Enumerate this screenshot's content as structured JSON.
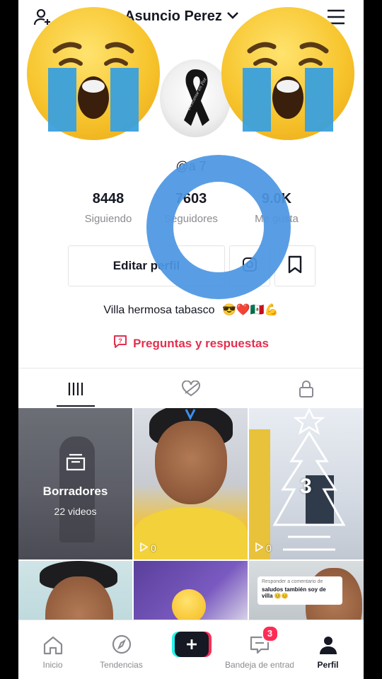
{
  "header": {
    "username": "Asuncio Perez",
    "add_user_icon": "person-plus-icon",
    "chevron_icon": "chevron-down-icon",
    "menu_icon": "hamburger-menu-icon"
  },
  "profile": {
    "handle": "@a                 7",
    "avatar_caption": "Descanse en Paz",
    "stats": [
      {
        "value": "8448",
        "label": "Siguiendo"
      },
      {
        "value": "7603",
        "label": "Seguidores"
      },
      {
        "value": "9.0K",
        "label": "Me gusta"
      }
    ],
    "edit_button": "Editar perfil",
    "bio": "Villa hermosa tabasco",
    "bio_emojis": "😎❤️🇲🇽💪",
    "qa_label": "Preguntas y respuestas"
  },
  "tabs": [
    {
      "icon": "grid-icon"
    },
    {
      "icon": "liked-heart-icon"
    },
    {
      "icon": "lock-icon"
    }
  ],
  "videos": [
    {
      "type": "drafts",
      "title": "Borradores",
      "subtitle": "22 videos"
    },
    {
      "plays": "0"
    },
    {
      "plays": "0",
      "overlay_text": "3"
    },
    {
      "overlay_title": "Responder a comentario de",
      "overlay_text": "saludos también soy de villa 😊😊"
    }
  ],
  "bottom_nav": [
    {
      "label": "Inicio",
      "icon": "home-icon"
    },
    {
      "label": "Tendencias",
      "icon": "compass-icon"
    },
    {
      "label": "",
      "icon": "plus-icon"
    },
    {
      "label": "Bandeja de entrada",
      "icon": "inbox-icon",
      "badge": "3"
    },
    {
      "label": "Perfil",
      "icon": "profile-icon"
    }
  ],
  "colors": {
    "accent": "#fe2c55",
    "qa_color": "#e2304f",
    "ring_color": "#4c97e3",
    "text_primary": "#161823",
    "text_secondary": "#8a8b91"
  }
}
